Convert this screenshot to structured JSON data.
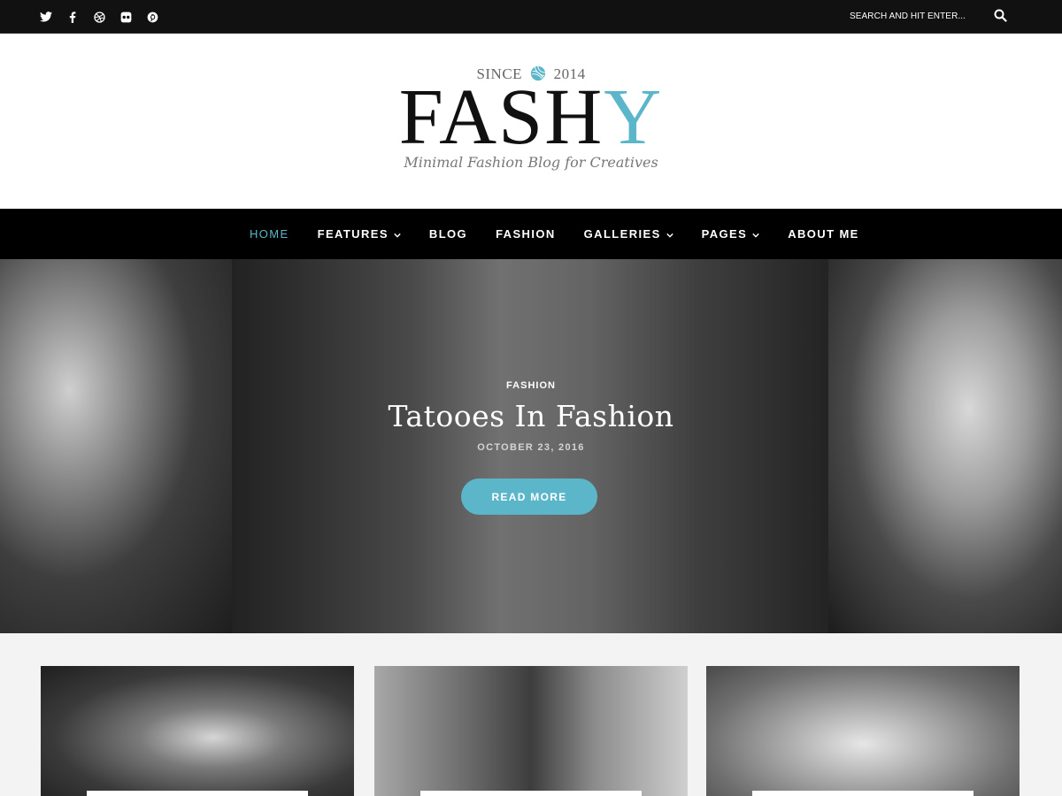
{
  "topbar": {
    "social_icons": [
      "twitter-icon",
      "facebook-icon",
      "dribbble-icon",
      "flickr-icon",
      "pinterest-icon"
    ],
    "search_placeholder": "SEARCH AND HIT ENTER...",
    "search_icon": "search-icon"
  },
  "brand": {
    "since": "SINCE",
    "since_year": "2014",
    "logo_main": "FASH",
    "logo_accent": "Y",
    "tagline": "Minimal Fashion Blog for Creatives",
    "accent_color": "#5bb6c9"
  },
  "nav": {
    "items": [
      {
        "label": "HOME",
        "active": true
      },
      {
        "label": "FEATURES",
        "dropdown": true
      },
      {
        "label": "BLOG"
      },
      {
        "label": "FASHION"
      },
      {
        "label": "GALLERIES",
        "dropdown": true
      },
      {
        "label": "PAGES",
        "dropdown": true
      },
      {
        "label": "ABOUT ME"
      }
    ]
  },
  "hero": {
    "category": "FASHION",
    "title": "Tatooes In Fashion",
    "date": "OCTOBER 23, 2016",
    "button": "READ MORE"
  }
}
